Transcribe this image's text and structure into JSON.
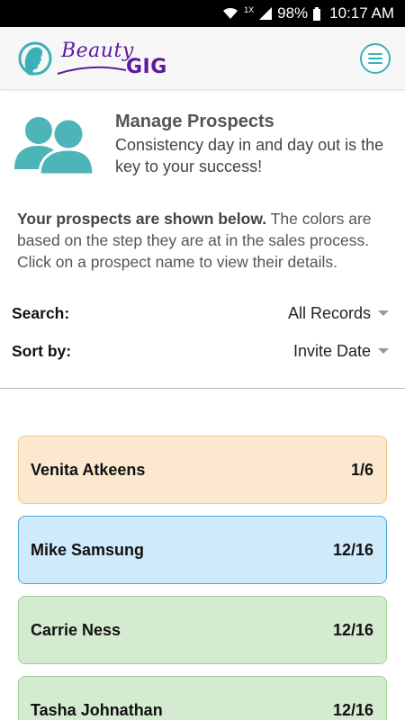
{
  "status_bar": {
    "network_label": "1X",
    "battery": "98%",
    "time": "10:17 AM"
  },
  "header": {
    "logo_word1": "Beauty",
    "logo_word2": "GIG",
    "menu_icon": "hamburger-menu-icon"
  },
  "intro": {
    "icon": "people-icon",
    "title": "Manage Prospects",
    "subtitle": "Consistency day in and day out is the key to your success!"
  },
  "instructions": {
    "bold": "Your prospects are shown below.",
    "text": " The colors are based on the step they are at in the sales process. Click on a prospect name to view their details."
  },
  "filters": {
    "search_label": "Search:",
    "search_value": "All Records",
    "sort_label": "Sort by:",
    "sort_value": "Invite Date"
  },
  "colors": {
    "accent": "#3bb0b8",
    "brand": "#5b1a9c"
  },
  "prospects": [
    {
      "name": "Venita Atkeens",
      "progress": "1/6",
      "bg": "#fbe8cf",
      "border": "#f0c98a"
    },
    {
      "name": "Mike Samsung",
      "progress": "12/16",
      "bg": "#cfeafb",
      "border": "#4aa7d8"
    },
    {
      "name": "Carrie Ness",
      "progress": "12/16",
      "bg": "#d5ebd1",
      "border": "#9fd094"
    },
    {
      "name": "Tasha Johnathan",
      "progress": "12/16",
      "bg": "#d5ebd1",
      "border": "#9fd094"
    }
  ]
}
